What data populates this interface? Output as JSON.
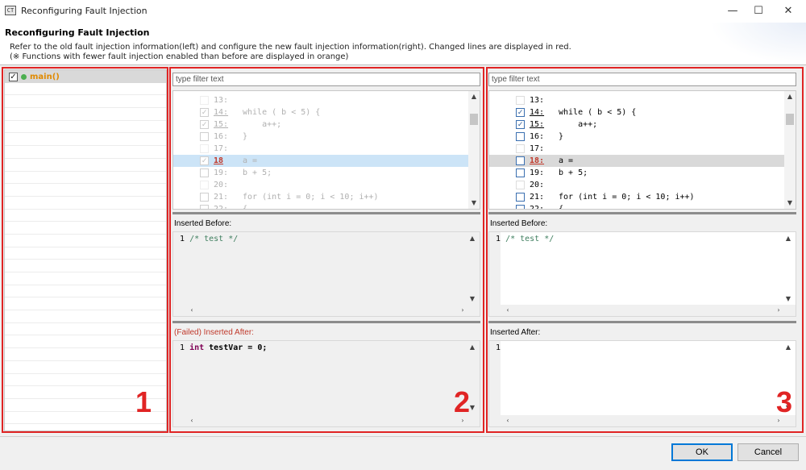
{
  "window": {
    "icon_text": "CT",
    "title": "Reconfiguring Fault Injection",
    "minimize": "—",
    "maximize": "☐",
    "close": "✕"
  },
  "header": {
    "title": "Reconfiguring Fault Injection",
    "line1": "Refer to the old fault injection information(left) and configure the new fault injection information(right). Changed lines are displayed in red.",
    "line2": "(※ Functions with fewer fault injection enabled than before are displayed in orange)"
  },
  "annotations": [
    "1",
    "2",
    "3"
  ],
  "colors": {
    "annotation": "#e02424",
    "changed_line": "#c0392b",
    "orange_function": "#e08a00",
    "code_keyword": "#7f0055",
    "comment": "#3f7f5f"
  },
  "tree": {
    "items": [
      {
        "label": "main()",
        "checked": true
      }
    ]
  },
  "old_panel": {
    "filter_placeholder": "type filter text",
    "lines": [
      {
        "num": "13:",
        "code": "",
        "checked": false
      },
      {
        "num": "14:",
        "code": "while ( b < 5) {",
        "checked": true
      },
      {
        "num": "15:",
        "code": "    a++;",
        "checked": true
      },
      {
        "num": "16:",
        "code": "}",
        "checked": false
      },
      {
        "num": "17:",
        "code": "",
        "checked": false
      },
      {
        "num": "18",
        "code": "a =",
        "checked": true
      },
      {
        "num": "19:",
        "code": "b + 5;",
        "checked": false
      },
      {
        "num": "20:",
        "code": "",
        "checked": false
      },
      {
        "num": "21:",
        "code": "for (int i = 0; i < 10; i++)",
        "checked": false
      },
      {
        "num": "22:",
        "code": "{",
        "checked": false
      }
    ],
    "inserted_before_label": "Inserted Before:",
    "inserted_before_line_no": "1",
    "inserted_before_code": "/* test */",
    "inserted_after_label": "(Failed) Inserted After:",
    "inserted_after_line_no": "1",
    "inserted_after_keyword": "int",
    "inserted_after_code": " testVar = 0;"
  },
  "new_panel": {
    "filter_placeholder": "type filter text",
    "lines": [
      {
        "num": "13:",
        "code": "",
        "checked": false
      },
      {
        "num": "14:",
        "code": "while ( b < 5) {",
        "checked": true
      },
      {
        "num": "15:",
        "code": "    a++;",
        "checked": true
      },
      {
        "num": "16:",
        "code": "}",
        "checked": false
      },
      {
        "num": "17:",
        "code": "",
        "checked": false
      },
      {
        "num": "18:",
        "code": "a =",
        "checked": false
      },
      {
        "num": "19:",
        "code": "b + 5;",
        "checked": false
      },
      {
        "num": "20:",
        "code": "",
        "checked": false
      },
      {
        "num": "21:",
        "code": "for (int i = 0; i < 10; i++)",
        "checked": false
      },
      {
        "num": "22:",
        "code": "{",
        "checked": false
      }
    ],
    "inserted_before_label": "Inserted Before:",
    "inserted_before_line_no": "1",
    "inserted_before_code": "/* test */",
    "inserted_after_label": "Inserted After:",
    "inserted_after_line_no": "1"
  },
  "footer": {
    "ok": "OK",
    "cancel": "Cancel"
  }
}
